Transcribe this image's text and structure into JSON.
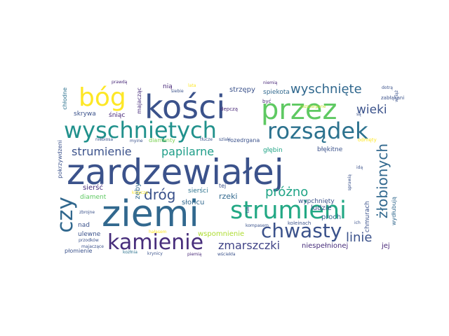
{
  "words": {
    "zardzewialej": {
      "text": "zardzewiałej",
      "color": "#3b528b"
    },
    "ziemi": {
      "text": "ziemi",
      "color": "#31688e"
    },
    "kosci": {
      "text": "kości",
      "color": "#3b528b"
    },
    "przez": {
      "text": "przez",
      "color": "#5ec962"
    },
    "wyschnietych": {
      "text": "wyschniętych",
      "color": "#21918c"
    },
    "rozsadek": {
      "text": "rozsądek",
      "color": "#2c728e"
    },
    "strumieni": {
      "text": "strumieni",
      "color": "#22a884"
    },
    "bog": {
      "text": "bóg",
      "color": "#fde725"
    },
    "czy": {
      "text": "czy",
      "color": "#31688e"
    },
    "kamienie": {
      "text": "kamienie",
      "color": "#472d7b"
    },
    "chwasty": {
      "text": "chwasty",
      "color": "#3b528b"
    },
    "wyschniete": {
      "text": "wyschnięte",
      "color": "#31688e"
    },
    "wieki": {
      "text": "wieki",
      "color": "#3b528b"
    },
    "zlobionych": {
      "text": "żłobionych",
      "color": "#31688e"
    },
    "strumienie": {
      "text": "strumienie",
      "color": "#3b528b"
    },
    "papilarne": {
      "text": "papilarne",
      "color": "#1f9e89"
    },
    "drog": {
      "text": "dróg",
      "color": "#3b528b"
    },
    "prozno": {
      "text": "próżno",
      "color": "#20a486"
    },
    "zmarszczki": {
      "text": "zmarszczki",
      "color": "#414487"
    },
    "linie": {
      "text": "linie",
      "color": "#3b528b"
    },
    "wspomnienie": {
      "text": "wspomnienie",
      "color": "#addc30"
    },
    "niespelnionej": {
      "text": "niespełnionej",
      "color": "#472d7b"
    },
    "jej": {
      "text": "jej",
      "color": "#482878"
    },
    "nia": {
      "text": "nią",
      "color": "#482878"
    },
    "strzepy": {
      "text": "strzępy",
      "color": "#3b528b"
    },
    "spiekota": {
      "text": "spiekota",
      "color": "#31688e"
    },
    "proch": {
      "text": "proch",
      "color": "#31688e"
    },
    "ludzie": {
      "text": "ludzie",
      "color": "#3b528b"
    },
    "rzeki": {
      "text": "rzeki",
      "color": "#31688e"
    },
    "sloncu": {
      "text": "słońcu",
      "color": "#31688e"
    },
    "siersc": {
      "text": "sierść",
      "color": "#472d7b"
    },
    "siersci": {
      "text": "sierści",
      "color": "#2c728e"
    },
    "nad": {
      "text": "nad",
      "color": "#3b528b"
    },
    "ulewne": {
      "text": "ulewne",
      "color": "#3b528b"
    },
    "plomienie": {
      "text": "płomienie",
      "color": "#3b528b"
    },
    "skrywa": {
      "text": "skrywa",
      "color": "#3b528b"
    },
    "sniac": {
      "text": "śniąc",
      "color": "#482878"
    },
    "majaczac": {
      "text": "majacząc",
      "color": "#472d7b"
    },
    "zeby": {
      "text": "zęby",
      "color": "#31688e"
    },
    "chlodne": {
      "text": "chłodne",
      "color": "#2c728e"
    },
    "pokrzywdzeni": {
      "text": "pokrzywdzeni",
      "color": "#3b528b"
    },
    "diament": {
      "text": "diament",
      "color": "#5ec962"
    },
    "diamenty": {
      "text": "diamenty",
      "color": "#7ad151"
    },
    "rozedrgana": {
      "text": "rozedrgana",
      "color": "#3b528b"
    },
    "glebin": {
      "text": "głębin",
      "color": "#20a486"
    },
    "blekitne": {
      "text": "błękitne",
      "color": "#3b528b"
    },
    "wypchniety": {
      "text": "wypchnięty",
      "color": "#3b528b"
    },
    "koleinach": {
      "text": "koleinach",
      "color": "#3b528b"
    },
    "chmurach": {
      "text": "chmurach",
      "color": "#3b528b"
    },
    "wydlubuja": {
      "text": "wydłubują",
      "color": "#31688e"
    },
    "tej": {
      "text": "tej",
      "color": "#3b528b"
    },
    "depcza": {
      "text": "depczą",
      "color": "#482878"
    },
    "byc": {
      "text": "być",
      "color": "#482878"
    },
    "prawda": {
      "text": "prawdą",
      "color": "#482878"
    },
    "niemia": {
      "text": "niemią",
      "color": "#482878"
    },
    "dotra": {
      "text": "dotrą",
      "color": "#3b528b"
    },
    "zablakani": {
      "text": "zabłąkani",
      "color": "#3b528b"
    },
    "odmety": {
      "text": "odmęty",
      "color": "#fde725"
    },
    "kompasem": {
      "text": "kompasem",
      "color": "#3b528b"
    },
    "krynicy": {
      "text": "krynicy",
      "color": "#3b528b"
    },
    "piemia": {
      "text": "piemią",
      "color": "#482878"
    },
    "wsciekla": {
      "text": "wściekła",
      "color": "#3b528b"
    },
    "przodkow": {
      "text": "przodków",
      "color": "#3b528b"
    },
    "kozlnia": {
      "text": "kozłnia",
      "color": "#2c728e"
    },
    "zbrojne": {
      "text": "zbrojne",
      "color": "#3b528b"
    },
    "majaczace": {
      "text": "majaczące",
      "color": "#3b528b"
    },
    "niebiosa": {
      "text": "niebiosa",
      "color": "#3b528b"
    },
    "myine": {
      "text": "myine",
      "color": "#3b528b"
    },
    "siebie": {
      "text": "siebie",
      "color": "#3b528b"
    },
    "szlaki": {
      "text": "szlaki",
      "color": "#3b528b"
    },
    "tlucze": {
      "text": "tłucze",
      "color": "#3b528b"
    },
    "sa": {
      "text": "są",
      "color": "#3b528b"
    },
    "ida": {
      "text": "idą",
      "color": "#3b528b"
    },
    "ich": {
      "text": "ich",
      "color": "#3b528b"
    },
    "sprawia": {
      "text": "sprawią",
      "color": "#3b528b"
    },
    "wciaz": {
      "text": "wciąż",
      "color": "#3b528b"
    },
    "rozszarpane": {
      "text": "rozszarpane",
      "color": "#bddf26"
    },
    "krzycza": {
      "text": "krzyczą",
      "color": "#fde725"
    },
    "halasem": {
      "text": "hałasem",
      "color": "#fde725"
    },
    "lata": {
      "text": "lata",
      "color": "#fde725"
    },
    "tak": {
      "text": "tak",
      "color": "#3b528b"
    }
  }
}
